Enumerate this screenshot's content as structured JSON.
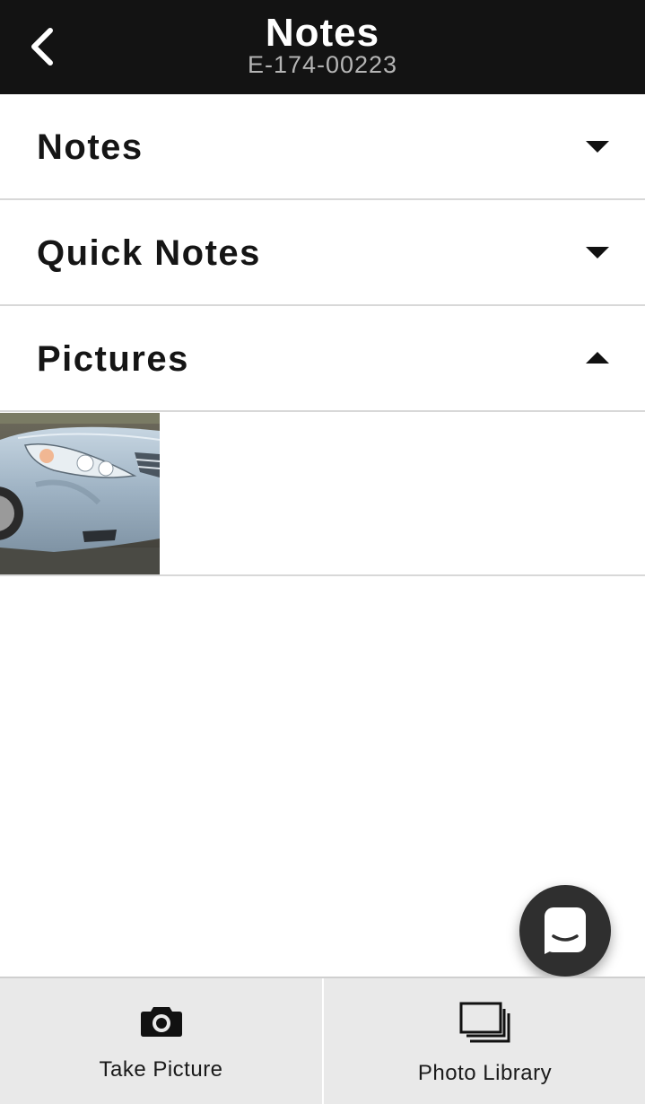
{
  "header": {
    "title": "Notes",
    "subtitle": "E-174-00223",
    "back_icon": "chevron-left-icon",
    "background": "#131313"
  },
  "sections": [
    {
      "label": "Notes",
      "state": "collapsed",
      "icon": "caret-down-icon"
    },
    {
      "label": "Quick Notes",
      "state": "collapsed",
      "icon": "caret-down-icon"
    },
    {
      "label": "Pictures",
      "state": "expanded",
      "icon": "caret-up-icon"
    }
  ],
  "pictures": [
    {
      "thumbnail": "car-photo",
      "alt": ""
    }
  ],
  "chat_button": {
    "icon": "chat-icon",
    "color": "#2f2f2f"
  },
  "bottom_bar": {
    "take_picture": {
      "label": "Take Picture",
      "icon": "camera-icon"
    },
    "photo_library": {
      "label": "Photo Library",
      "icon": "photo-library-icon"
    },
    "background": "#e9e9e9"
  }
}
